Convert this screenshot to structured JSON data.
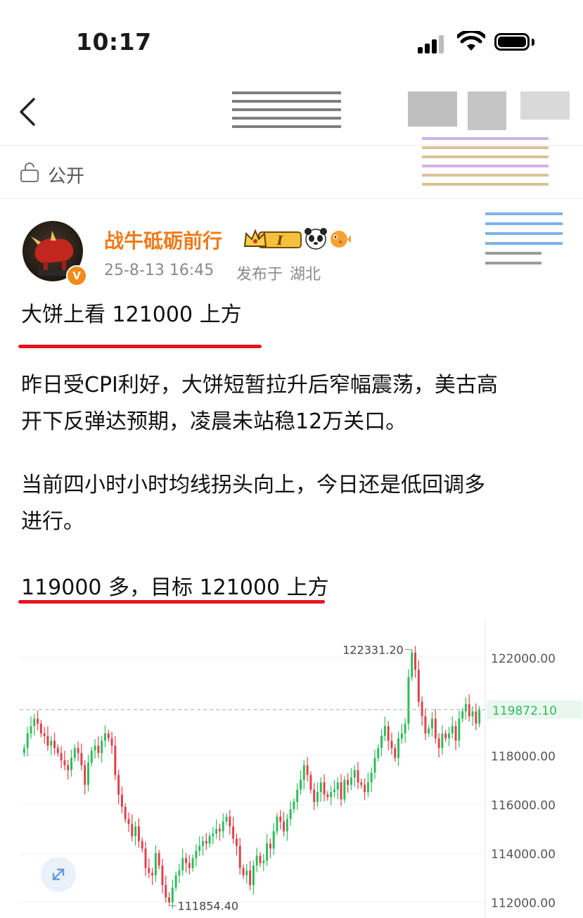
{
  "status_bar": {
    "time": "10:17"
  },
  "post": {
    "visibility": "公开",
    "author": {
      "name": "战牛砥砺前行",
      "verified_badge": "V",
      "level_badge": "I",
      "timestamp": "25-8-13 16:45",
      "published_in_prefix": "发布于",
      "location": "湖北"
    },
    "headline": "大饼上看 121000 上方",
    "body": [
      "昨日受CPI利好，大饼短暂拉升后窄幅震荡，美古高",
      "开下反弹达预期，凌晨未站稳12万关口。",
      "当前四小时小时均线拐头向上，今日还是低回调多",
      "进行。",
      "119000 多，目标 121000 上方"
    ]
  },
  "icons": {
    "back": "chevron-left-icon",
    "lock": "lock-icon",
    "signal": "cellular-signal-icon",
    "wifi": "wifi-icon",
    "battery": "battery-icon",
    "crown": "crown-icon",
    "panda": "panda-emoji-icon",
    "fish": "pufferfish-emoji-icon",
    "expand": "expand-icon"
  },
  "colors": {
    "accent_orange": "#f07a18",
    "underline_red": "#e4151b",
    "candle_up": "#2dbd5b",
    "candle_down": "#e0414b",
    "current_price": "#2dbd5b"
  },
  "chart_data": {
    "type": "candlestick",
    "y_ticks": [
      "122000.00",
      "118000.00",
      "116000.00",
      "114000.00",
      "112000.00"
    ],
    "ylim": [
      111500,
      123000
    ],
    "high_label": "122331.20",
    "high_value": 122331.2,
    "low_label": "111854.40",
    "low_value": 111854.4,
    "current_price_label": "119872.10",
    "current_price": 119872.1,
    "closes": [
      118300,
      118900,
      119200,
      119500,
      119300,
      118900,
      118800,
      118400,
      118600,
      118300,
      118100,
      117800,
      117600,
      117400,
      117900,
      118300,
      118100,
      117600,
      116800,
      117700,
      118200,
      118400,
      118100,
      118600,
      118900,
      118700,
      118400,
      117200,
      116400,
      115900,
      115400,
      115200,
      114700,
      115100,
      114500,
      114200,
      113400,
      113200,
      113100,
      114000,
      113500,
      112700,
      112200,
      112000,
      112600,
      113100,
      113300,
      113800,
      113600,
      113400,
      113800,
      114100,
      114300,
      114500,
      114400,
      114700,
      114800,
      115000,
      114900,
      115300,
      115500,
      115100,
      114600,
      114300,
      113400,
      113100,
      113300,
      112700,
      113500,
      113900,
      113600,
      113700,
      114400,
      114200,
      114900,
      115500,
      115300,
      114900,
      115400,
      115800,
      116100,
      116600,
      117000,
      117600,
      117200,
      116600,
      116100,
      116500,
      116900,
      116400,
      116300,
      116500,
      116600,
      116900,
      116200,
      117000,
      116800,
      117100,
      117400,
      116900,
      116800,
      116500,
      116900,
      117300,
      117900,
      118300,
      118800,
      119200,
      118600,
      118300,
      117900,
      118700,
      118900,
      119300,
      121200,
      122200,
      121500,
      120200,
      119600,
      118900,
      119100,
      119500,
      118700,
      118300,
      118900,
      118700,
      118900,
      119200,
      118600,
      119500,
      119800,
      120100,
      119600,
      119800,
      119300,
      119872
    ]
  }
}
